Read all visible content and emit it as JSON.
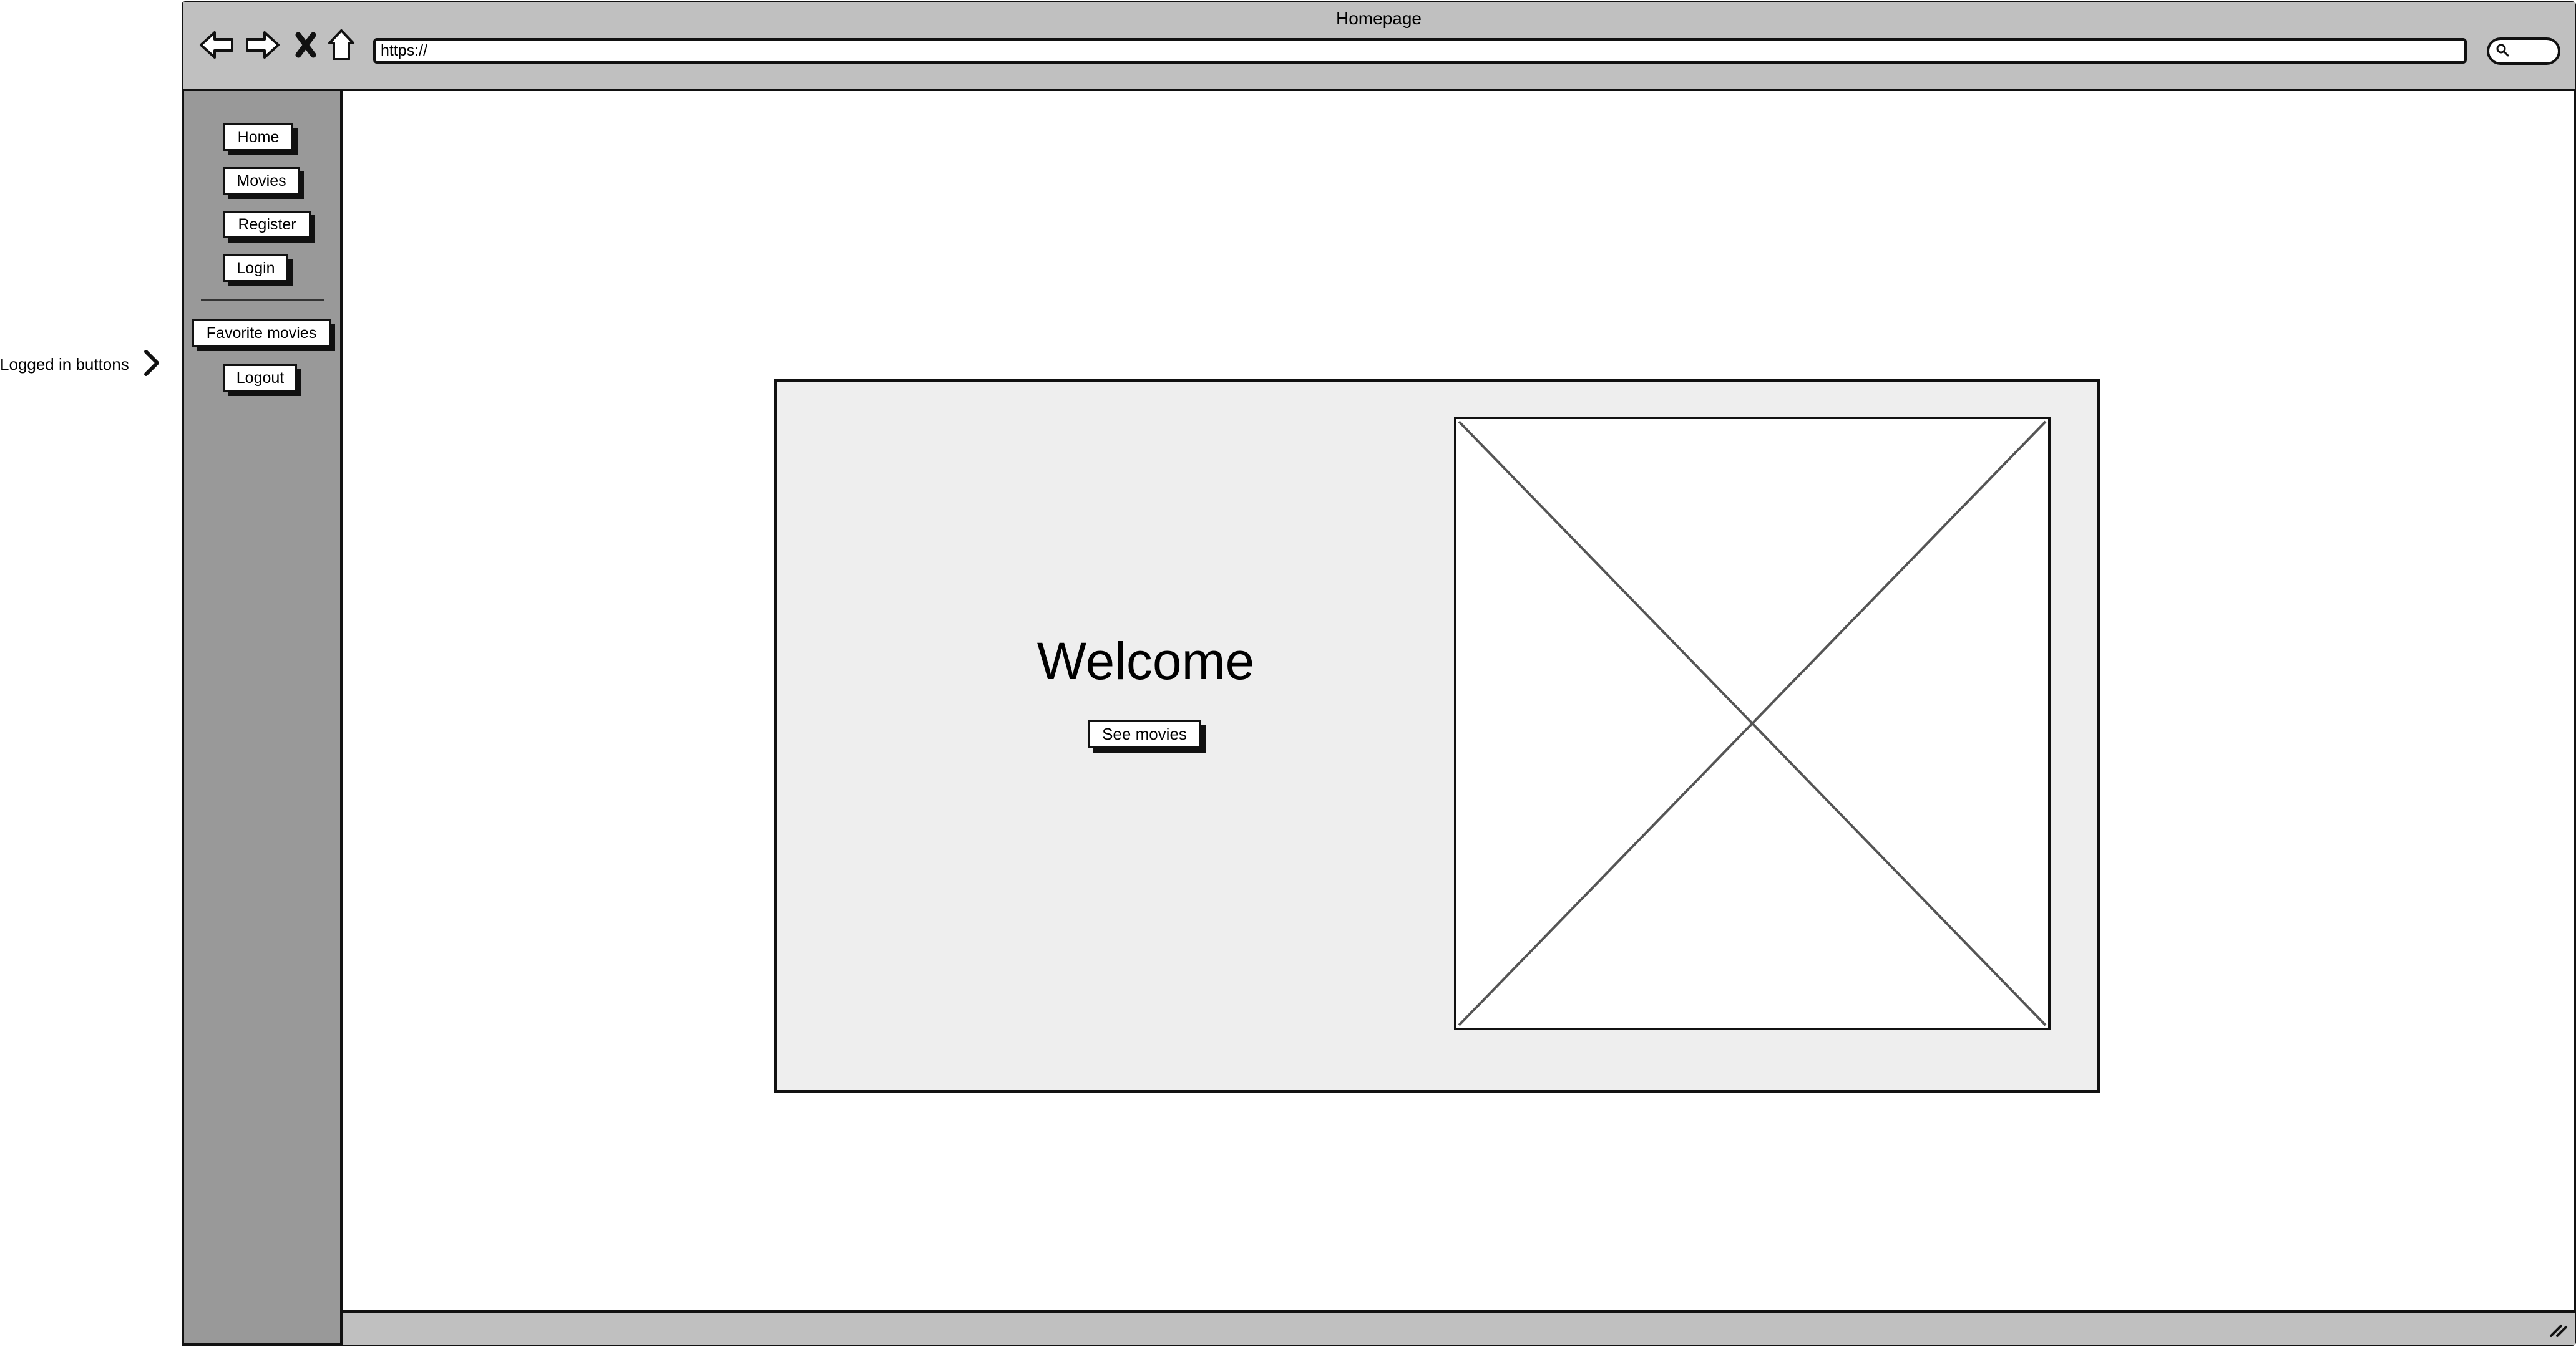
{
  "window": {
    "title": "Homepage"
  },
  "toolbar": {
    "back_icon": "back-arrow-icon",
    "forward_icon": "forward-arrow-icon",
    "stop_icon": "stop-x-icon",
    "home_icon": "home-icon",
    "url": "https://",
    "search_icon": "search-icon"
  },
  "sidebar": {
    "items": [
      {
        "label": "Home"
      },
      {
        "label": "Movies"
      },
      {
        "label": "Register"
      },
      {
        "label": "Login"
      },
      {
        "label": "Favorite movies"
      },
      {
        "label": "Logout"
      }
    ]
  },
  "annotation": {
    "label": "Logged in buttons",
    "arrow_icon": "chevron-right-icon"
  },
  "hero": {
    "heading": "Welcome",
    "button_label": "See movies",
    "image_icon": "image-placeholder-icon"
  },
  "colors": {
    "title_bar": "#c0c0c0",
    "sidebar": "#999999",
    "panel": "#eeeeee",
    "outline": "#111111"
  }
}
